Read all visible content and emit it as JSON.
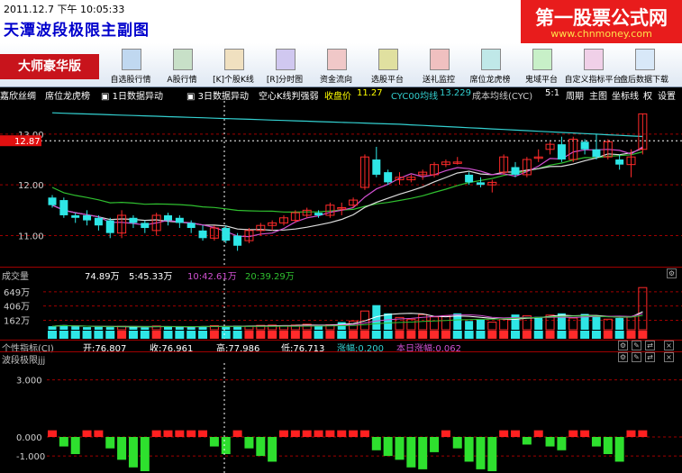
{
  "window": {
    "date": "2011.12.7",
    "period": "下午",
    "time": "10:05:33",
    "title": "天潭波段极限主副图",
    "brand": "第一股票公式网",
    "brand_url": "www.chnmoney.com"
  },
  "toolbar": {
    "edition": "大师豪华版",
    "buttons": [
      {
        "label": "自选股行情",
        "icon": "watchlist-icon"
      },
      {
        "label": "A股行情",
        "icon": "a-share-icon"
      },
      {
        "label": "[K]个股K线",
        "icon": "kline-icon"
      },
      {
        "label": "[R]分时图",
        "icon": "intraday-icon"
      },
      {
        "label": "资金流向",
        "icon": "money-flow-icon"
      },
      {
        "label": "选股平台",
        "icon": "stock-picker-icon"
      },
      {
        "label": "送礼监控",
        "icon": "gift-icon"
      },
      {
        "label": "席位龙虎榜",
        "icon": "dragon-tiger-icon"
      },
      {
        "label": "鬼域平台",
        "icon": "ghost-icon"
      },
      {
        "label": "自定义指标平台",
        "icon": "custom-indicator-icon"
      },
      {
        "label": "盘后数据下载",
        "icon": "download-icon"
      }
    ]
  },
  "chart_header": {
    "stock": "嘉欣丝绸",
    "seat": "席位龙虎榜",
    "check1": "1日数据异动",
    "check2": "3日数据异动",
    "check3": "空心K线判强弱",
    "close_label": "收盘价",
    "close_value": "11.27",
    "cyc_label": "CYC00均线",
    "cyc_value": "13.229",
    "cost_line": "成本均线(CYC)",
    "ratio": "5:1",
    "period": "周期",
    "main": "主图",
    "axis": "坐标线",
    "right": "权",
    "settings": "设置"
  },
  "price_axis": {
    "ticks": [
      "13.00",
      "12.00",
      "11.00"
    ],
    "current": "12.87"
  },
  "volume_panel": {
    "title": "成交量",
    "total": "74.89万",
    "ma5": "5:45.33万",
    "ma10": "10:42.61万",
    "ma20": "20:39.29万",
    "ticks": [
      "649万",
      "406万",
      "162万"
    ]
  },
  "indicator_panel": {
    "name": "个性指标(CI)",
    "open": "开:76.807",
    "close": "收:76.961",
    "high": "高:77.986",
    "low": "低:76.713",
    "rise": "涨幅:0.200",
    "today": "本日涨幅:0.062"
  },
  "wave_panel": {
    "name": "波段极限jjj",
    "ticks": [
      "3.000",
      "0.000",
      "-1.000"
    ]
  },
  "colors": {
    "up": "#ff2a2a",
    "down": "#2ee6e6",
    "cyc": "#33d0d0",
    "ma_green": "#2fbf2f",
    "ma_white": "#dddddd",
    "ma_purple": "#d050d0",
    "grid": "#a00000",
    "bar_red": "#ff2020",
    "bar_green": "#2ee02e"
  },
  "chart_data": [
    {
      "type": "candlestick",
      "ylim": [
        10.6,
        13.3
      ],
      "ticks": [
        13.0,
        12.0,
        11.0
      ],
      "current_price": 12.87,
      "open": [
        11.75,
        11.7,
        11.4,
        11.4,
        11.35,
        11.3,
        11.05,
        11.35,
        11.25,
        11.1,
        11.4,
        11.35,
        11.25,
        11.1,
        10.95,
        11.15,
        11.0,
        10.9,
        11.1,
        11.2,
        11.25,
        11.3,
        11.4,
        11.45,
        11.4,
        11.55,
        11.6,
        11.95,
        12.5,
        12.25,
        12.1,
        12.1,
        12.2,
        12.2,
        12.4,
        12.45,
        12.2,
        12.05,
        12.0,
        12.25,
        12.35,
        12.2,
        12.55,
        12.7,
        12.8,
        12.5,
        12.85,
        12.7,
        12.55,
        12.5,
        12.4,
        12.7
      ],
      "close": [
        11.6,
        11.4,
        11.35,
        11.3,
        11.2,
        11.05,
        11.4,
        11.25,
        11.15,
        11.4,
        11.3,
        11.25,
        11.15,
        10.95,
        11.15,
        10.9,
        10.8,
        11.1,
        11.2,
        11.25,
        11.35,
        11.45,
        11.5,
        11.4,
        11.6,
        11.55,
        11.7,
        12.55,
        12.2,
        12.05,
        12.15,
        12.15,
        12.25,
        12.4,
        12.45,
        12.45,
        12.05,
        12.0,
        12.05,
        12.55,
        12.2,
        12.5,
        12.55,
        12.8,
        12.5,
        12.9,
        12.7,
        12.55,
        12.85,
        12.4,
        12.55,
        13.4
      ],
      "high": [
        11.8,
        11.75,
        11.45,
        11.5,
        11.4,
        11.35,
        11.5,
        11.4,
        11.3,
        11.45,
        11.45,
        11.4,
        11.3,
        11.2,
        11.2,
        11.2,
        11.05,
        11.15,
        11.25,
        11.3,
        11.4,
        11.5,
        11.55,
        11.5,
        11.65,
        11.65,
        11.75,
        12.6,
        12.75,
        12.3,
        12.25,
        12.2,
        12.3,
        12.45,
        12.5,
        12.55,
        12.25,
        12.15,
        12.1,
        12.6,
        12.45,
        12.55,
        12.7,
        12.85,
        12.95,
        12.95,
        12.9,
        13.0,
        12.9,
        12.6,
        12.7,
        13.4
      ],
      "low": [
        11.55,
        11.35,
        11.25,
        11.2,
        11.1,
        10.95,
        10.95,
        11.15,
        11.05,
        11.0,
        11.2,
        11.15,
        11.05,
        10.9,
        10.9,
        10.85,
        10.7,
        10.85,
        11.0,
        11.1,
        11.2,
        11.25,
        11.35,
        11.35,
        11.35,
        11.4,
        11.55,
        11.9,
        12.15,
        12.0,
        12.0,
        12.05,
        12.1,
        12.15,
        12.35,
        12.4,
        12.0,
        11.95,
        11.85,
        12.2,
        12.15,
        12.15,
        12.45,
        12.6,
        12.45,
        12.45,
        12.6,
        12.5,
        12.5,
        12.3,
        12.15,
        12.6
      ]
    },
    {
      "type": "bar",
      "title": "成交量",
      "ylim": [
        0,
        800
      ],
      "ticks": [
        649,
        406,
        162
      ],
      "values": [
        60,
        80,
        60,
        45,
        50,
        45,
        60,
        55,
        40,
        65,
        50,
        55,
        45,
        60,
        70,
        55,
        70,
        60,
        75,
        80,
        70,
        80,
        95,
        70,
        85,
        130,
        150,
        320,
        420,
        280,
        210,
        180,
        260,
        220,
        240,
        280,
        150,
        170,
        130,
        180,
        260,
        240,
        220,
        250,
        280,
        200,
        270,
        220,
        180,
        200,
        220,
        720
      ],
      "up": [
        false,
        false,
        false,
        false,
        false,
        false,
        true,
        false,
        false,
        true,
        false,
        false,
        false,
        false,
        true,
        false,
        false,
        true,
        true,
        true,
        true,
        true,
        true,
        false,
        true,
        false,
        true,
        true,
        false,
        false,
        true,
        true,
        true,
        true,
        true,
        false,
        false,
        false,
        true,
        true,
        false,
        true,
        false,
        true,
        false,
        true,
        false,
        false,
        true,
        false,
        true,
        true
      ]
    },
    {
      "type": "bar",
      "title": "波段极限jjj",
      "ylim": [
        -1.8,
        3.6
      ],
      "ticks": [
        3.0,
        0.0,
        -1.0
      ],
      "values": [
        0.35,
        -0.5,
        -0.9,
        0.35,
        0.35,
        -0.6,
        -1.2,
        -1.6,
        -1.8,
        0.35,
        0.35,
        0.35,
        0.35,
        0.35,
        -0.5,
        -0.9,
        0.35,
        -0.6,
        -1.0,
        -1.3,
        0.35,
        0.35,
        0.35,
        0.35,
        0.35,
        0.35,
        0.35,
        0.35,
        -0.7,
        -1.0,
        -1.2,
        -1.6,
        -1.7,
        -0.8,
        0.35,
        -0.6,
        -1.3,
        -1.7,
        -1.8,
        0.35,
        0.35,
        -0.4,
        0.35,
        -0.5,
        -0.7,
        0.35,
        0.35,
        -0.5,
        -0.9,
        -1.3,
        0.35,
        0.35
      ]
    }
  ]
}
